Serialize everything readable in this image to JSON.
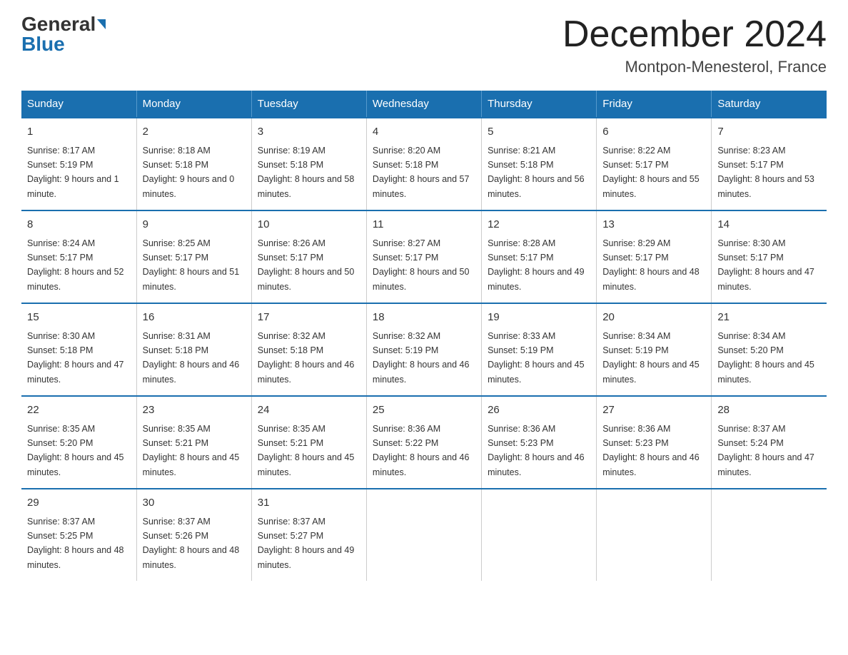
{
  "header": {
    "logo_general": "General",
    "logo_blue": "Blue",
    "title": "December 2024",
    "location": "Montpon-Menesterol, France"
  },
  "days_of_week": [
    "Sunday",
    "Monday",
    "Tuesday",
    "Wednesday",
    "Thursday",
    "Friday",
    "Saturday"
  ],
  "weeks": [
    [
      {
        "day": "1",
        "sunrise": "8:17 AM",
        "sunset": "5:19 PM",
        "daylight": "9 hours and 1 minute."
      },
      {
        "day": "2",
        "sunrise": "8:18 AM",
        "sunset": "5:18 PM",
        "daylight": "9 hours and 0 minutes."
      },
      {
        "day": "3",
        "sunrise": "8:19 AM",
        "sunset": "5:18 PM",
        "daylight": "8 hours and 58 minutes."
      },
      {
        "day": "4",
        "sunrise": "8:20 AM",
        "sunset": "5:18 PM",
        "daylight": "8 hours and 57 minutes."
      },
      {
        "day": "5",
        "sunrise": "8:21 AM",
        "sunset": "5:18 PM",
        "daylight": "8 hours and 56 minutes."
      },
      {
        "day": "6",
        "sunrise": "8:22 AM",
        "sunset": "5:17 PM",
        "daylight": "8 hours and 55 minutes."
      },
      {
        "day": "7",
        "sunrise": "8:23 AM",
        "sunset": "5:17 PM",
        "daylight": "8 hours and 53 minutes."
      }
    ],
    [
      {
        "day": "8",
        "sunrise": "8:24 AM",
        "sunset": "5:17 PM",
        "daylight": "8 hours and 52 minutes."
      },
      {
        "day": "9",
        "sunrise": "8:25 AM",
        "sunset": "5:17 PM",
        "daylight": "8 hours and 51 minutes."
      },
      {
        "day": "10",
        "sunrise": "8:26 AM",
        "sunset": "5:17 PM",
        "daylight": "8 hours and 50 minutes."
      },
      {
        "day": "11",
        "sunrise": "8:27 AM",
        "sunset": "5:17 PM",
        "daylight": "8 hours and 50 minutes."
      },
      {
        "day": "12",
        "sunrise": "8:28 AM",
        "sunset": "5:17 PM",
        "daylight": "8 hours and 49 minutes."
      },
      {
        "day": "13",
        "sunrise": "8:29 AM",
        "sunset": "5:17 PM",
        "daylight": "8 hours and 48 minutes."
      },
      {
        "day": "14",
        "sunrise": "8:30 AM",
        "sunset": "5:17 PM",
        "daylight": "8 hours and 47 minutes."
      }
    ],
    [
      {
        "day": "15",
        "sunrise": "8:30 AM",
        "sunset": "5:18 PM",
        "daylight": "8 hours and 47 minutes."
      },
      {
        "day": "16",
        "sunrise": "8:31 AM",
        "sunset": "5:18 PM",
        "daylight": "8 hours and 46 minutes."
      },
      {
        "day": "17",
        "sunrise": "8:32 AM",
        "sunset": "5:18 PM",
        "daylight": "8 hours and 46 minutes."
      },
      {
        "day": "18",
        "sunrise": "8:32 AM",
        "sunset": "5:19 PM",
        "daylight": "8 hours and 46 minutes."
      },
      {
        "day": "19",
        "sunrise": "8:33 AM",
        "sunset": "5:19 PM",
        "daylight": "8 hours and 45 minutes."
      },
      {
        "day": "20",
        "sunrise": "8:34 AM",
        "sunset": "5:19 PM",
        "daylight": "8 hours and 45 minutes."
      },
      {
        "day": "21",
        "sunrise": "8:34 AM",
        "sunset": "5:20 PM",
        "daylight": "8 hours and 45 minutes."
      }
    ],
    [
      {
        "day": "22",
        "sunrise": "8:35 AM",
        "sunset": "5:20 PM",
        "daylight": "8 hours and 45 minutes."
      },
      {
        "day": "23",
        "sunrise": "8:35 AM",
        "sunset": "5:21 PM",
        "daylight": "8 hours and 45 minutes."
      },
      {
        "day": "24",
        "sunrise": "8:35 AM",
        "sunset": "5:21 PM",
        "daylight": "8 hours and 45 minutes."
      },
      {
        "day": "25",
        "sunrise": "8:36 AM",
        "sunset": "5:22 PM",
        "daylight": "8 hours and 46 minutes."
      },
      {
        "day": "26",
        "sunrise": "8:36 AM",
        "sunset": "5:23 PM",
        "daylight": "8 hours and 46 minutes."
      },
      {
        "day": "27",
        "sunrise": "8:36 AM",
        "sunset": "5:23 PM",
        "daylight": "8 hours and 46 minutes."
      },
      {
        "day": "28",
        "sunrise": "8:37 AM",
        "sunset": "5:24 PM",
        "daylight": "8 hours and 47 minutes."
      }
    ],
    [
      {
        "day": "29",
        "sunrise": "8:37 AM",
        "sunset": "5:25 PM",
        "daylight": "8 hours and 48 minutes."
      },
      {
        "day": "30",
        "sunrise": "8:37 AM",
        "sunset": "5:26 PM",
        "daylight": "8 hours and 48 minutes."
      },
      {
        "day": "31",
        "sunrise": "8:37 AM",
        "sunset": "5:27 PM",
        "daylight": "8 hours and 49 minutes."
      },
      null,
      null,
      null,
      null
    ]
  ]
}
